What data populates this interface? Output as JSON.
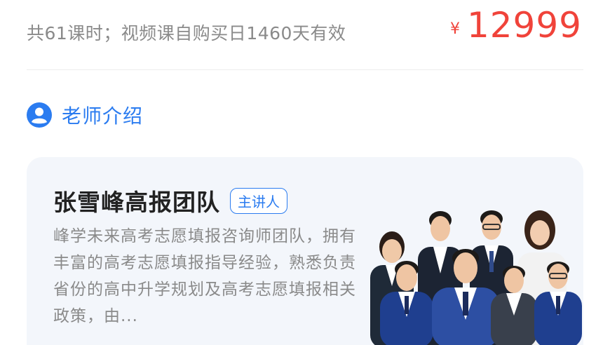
{
  "course": {
    "meta_text": "共61课时；视频课自购买日1460天有效",
    "price_currency": "¥",
    "price_amount": "12999"
  },
  "section": {
    "icon": "user-avatar-icon",
    "title": "老师介绍"
  },
  "teacher": {
    "name": "张雪峰高报团队",
    "role_tag": "主讲人",
    "description": "峰学未来高考志愿填报咨询师团队，拥有丰富的高考志愿填报指导经验，熟悉负责省份的高中升学规划及高考志愿填报相关政策，由..."
  },
  "colors": {
    "price": "#f0433a",
    "accent": "#2b7cf0",
    "muted_text": "#8a8a8a",
    "card_bg": "#f3f6fb"
  }
}
